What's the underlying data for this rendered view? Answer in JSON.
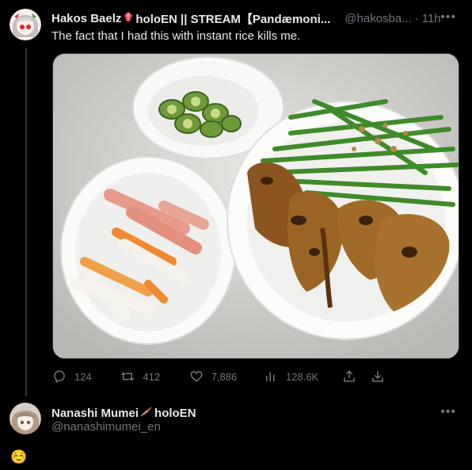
{
  "tweet": {
    "name": "Hakos Baelz",
    "name_suffix": "holoEN || STREAM【Pandæmoni...",
    "handle": "@hakosba...",
    "time": "11h",
    "text": "The fact that I had this with instant rice kills me.",
    "actions": {
      "reply_count": "124",
      "retweet_count": "412",
      "like_count": "7,886",
      "views_count": "128.6K"
    }
  },
  "reply": {
    "name": "Nanashi Mumei",
    "name_suffix": "holoEN",
    "handle": "@nanashimumei_en",
    "emoji": "☺️"
  },
  "colors": {
    "background": "#000000",
    "text": "#e7e9ea",
    "muted": "#71767b"
  },
  "icons": [
    "more-icon",
    "reply-icon",
    "retweet-icon",
    "like-icon",
    "views-icon",
    "share-icon",
    "download-icon"
  ]
}
